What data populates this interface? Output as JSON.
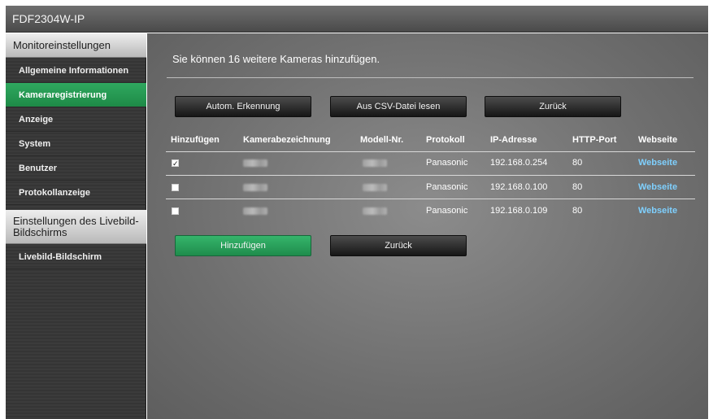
{
  "window": {
    "title": "FDF2304W-IP"
  },
  "sidebar": {
    "section1": "Monitoreinstellungen",
    "items": [
      {
        "label": "Allgemeine Informationen"
      },
      {
        "label": "Kameraregistrierung"
      },
      {
        "label": "Anzeige"
      },
      {
        "label": "System"
      },
      {
        "label": "Benutzer"
      },
      {
        "label": "Protokollanzeige"
      }
    ],
    "section2": "Einstellungen des Livebild-Bildschirms",
    "items2": [
      {
        "label": "Livebild-Bildschirm"
      }
    ]
  },
  "main": {
    "info": "Sie können 16 weitere Kameras hinzufügen.",
    "buttons": {
      "auto": "Autom. Erkennung",
      "csv": "Aus CSV-Datei lesen",
      "back_top": "Zurück",
      "add": "Hinzufügen",
      "back_bottom": "Zurück"
    },
    "table": {
      "headers": [
        "Hinzufügen",
        "Kamerabezeichnung",
        "Modell-Nr.",
        "Protokoll",
        "IP-Adresse",
        "HTTP-Port",
        "Webseite"
      ],
      "rows": [
        {
          "checked": true,
          "protocol": "Panasonic",
          "ip": "192.168.0.254",
          "port": "80",
          "web": "Webseite"
        },
        {
          "checked": false,
          "protocol": "Panasonic",
          "ip": "192.168.0.100",
          "port": "80",
          "web": "Webseite"
        },
        {
          "checked": false,
          "protocol": "Panasonic",
          "ip": "192.168.0.109",
          "port": "80",
          "web": "Webseite"
        }
      ]
    }
  },
  "colors": {
    "accent_green": "#27a05a",
    "link": "#7fd0ff"
  }
}
